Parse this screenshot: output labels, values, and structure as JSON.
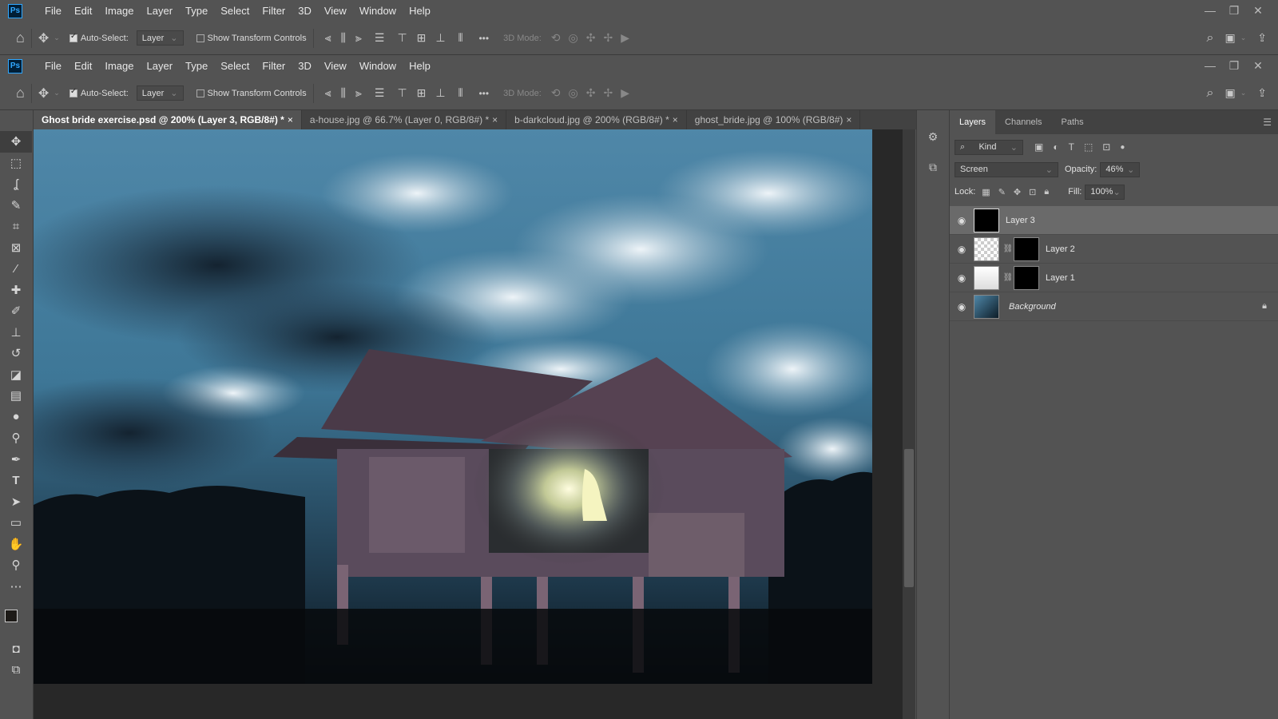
{
  "app": {
    "logo": "Ps"
  },
  "menu": [
    "File",
    "Edit",
    "Image",
    "Layer",
    "Type",
    "Select",
    "Filter",
    "3D",
    "View",
    "Window",
    "Help"
  ],
  "window_controls": {
    "minimize": "—",
    "restore": "❐",
    "close": "✕"
  },
  "options": {
    "auto_select_label": "Auto-Select:",
    "auto_select_value": "Layer",
    "transform_label": "Show Transform Controls",
    "mode_3d_label": "3D Mode:",
    "more": "•••"
  },
  "tabs": [
    {
      "label": "Ghost bride exercise.psd @ 200% (Layer 3, RGB/8#) *",
      "close": "×",
      "active": true
    },
    {
      "label": "a-house.jpg @ 66.7% (Layer 0, RGB/8#) *",
      "close": "×",
      "active": false
    },
    {
      "label": "b-darkcloud.jpg @ 200% (RGB/8#) *",
      "close": "×",
      "active": false
    },
    {
      "label": "ghost_bride.jpg @ 100% (RGB/8#)",
      "close": "×",
      "active": false
    }
  ],
  "panel": {
    "tabs": [
      "Layers",
      "Channels",
      "Paths"
    ],
    "filter_kind": "Kind",
    "blend_mode": "Screen",
    "opacity_label": "Opacity:",
    "opacity_value": "46%",
    "lock_label": "Lock:",
    "fill_label": "Fill:",
    "fill_value": "100%"
  },
  "layers": [
    {
      "name": "Layer 3",
      "selected": true,
      "mask": false
    },
    {
      "name": "Layer 2",
      "selected": false,
      "mask": true
    },
    {
      "name": "Layer 1",
      "selected": false,
      "mask": true
    },
    {
      "name": "Background",
      "selected": false,
      "mask": false,
      "locked": true
    }
  ],
  "colors": {
    "accent": "#31a8ff",
    "panel_bg": "#535353",
    "tab_bg": "#424242",
    "selected_layer": "#6a6a6a"
  }
}
